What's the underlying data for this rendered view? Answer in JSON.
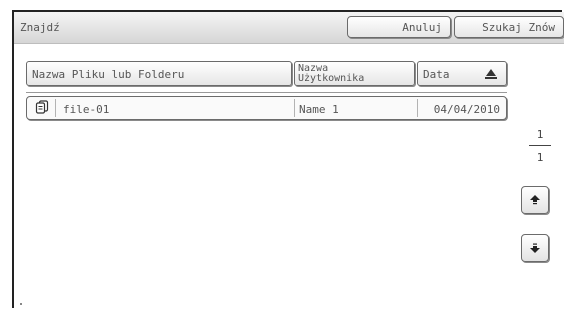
{
  "topbar": {
    "title": "Znajdź",
    "cancel_label": "Anuluj",
    "search_again_label": "Szukaj Znów"
  },
  "columns": {
    "name": "Nazwa Pliku lub Folderu",
    "user_line1": "Nazwa",
    "user_line2": "Użytkownika",
    "date": "Data"
  },
  "rows": [
    {
      "icon": "file-stack-icon",
      "name": "file-01",
      "user": "Name 1",
      "date": "04/04/2010"
    }
  ],
  "pager": {
    "current": "1",
    "total": "1"
  },
  "icons": {
    "scroll_up": "arrow-up-icon",
    "scroll_down": "arrow-down-icon"
  }
}
